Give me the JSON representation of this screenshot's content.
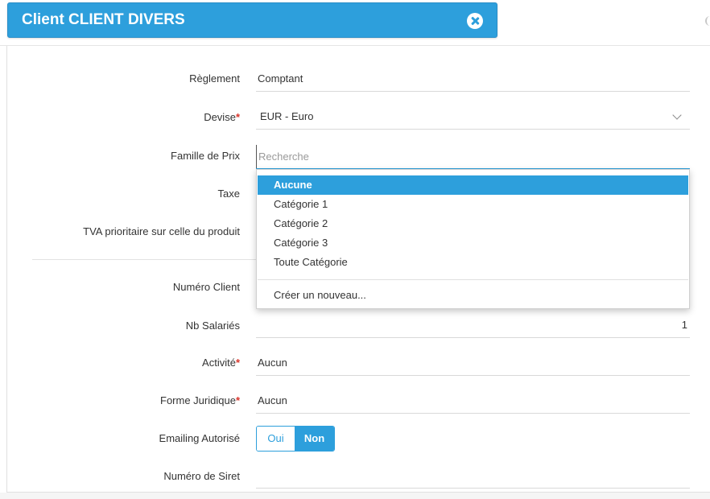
{
  "header": {
    "title": "Client CLIENT DIVERS"
  },
  "form": {
    "reglement": {
      "label": "Règlement",
      "value": "Comptant"
    },
    "devise": {
      "label": "Devise",
      "required_mark": "*",
      "value": "EUR - Euro"
    },
    "famille_prix": {
      "label": "Famille de Prix",
      "placeholder": "Recherche"
    },
    "taxe": {
      "label": "Taxe"
    },
    "tva": {
      "label": "TVA prioritaire sur celle du produit"
    },
    "numero_client": {
      "label": "Numéro Client"
    },
    "nb_salaries": {
      "label": "Nb Salariés",
      "value": "1"
    },
    "activite": {
      "label": "Activité",
      "required_mark": "*",
      "value": "Aucun"
    },
    "forme_juridique": {
      "label": "Forme Juridique",
      "required_mark": "*",
      "value": "Aucun"
    },
    "emailing": {
      "label": "Emailing Autorisé",
      "options": [
        "Oui",
        "Non"
      ],
      "selected": "Non"
    },
    "siret": {
      "label": "Numéro de Siret"
    }
  },
  "dropdown": {
    "items": [
      "Aucune",
      "Catégorie 1",
      "Catégorie 2",
      "Catégorie 3",
      "Toute Catégorie"
    ],
    "highlighted": "Aucune",
    "create_label": "Créer un nouveau..."
  },
  "colors": {
    "accent": "#2d9fdc",
    "required": "#d9342b"
  },
  "icons": {
    "close": "close-circle-icon",
    "select_arrow": "chevron-down-icon"
  }
}
